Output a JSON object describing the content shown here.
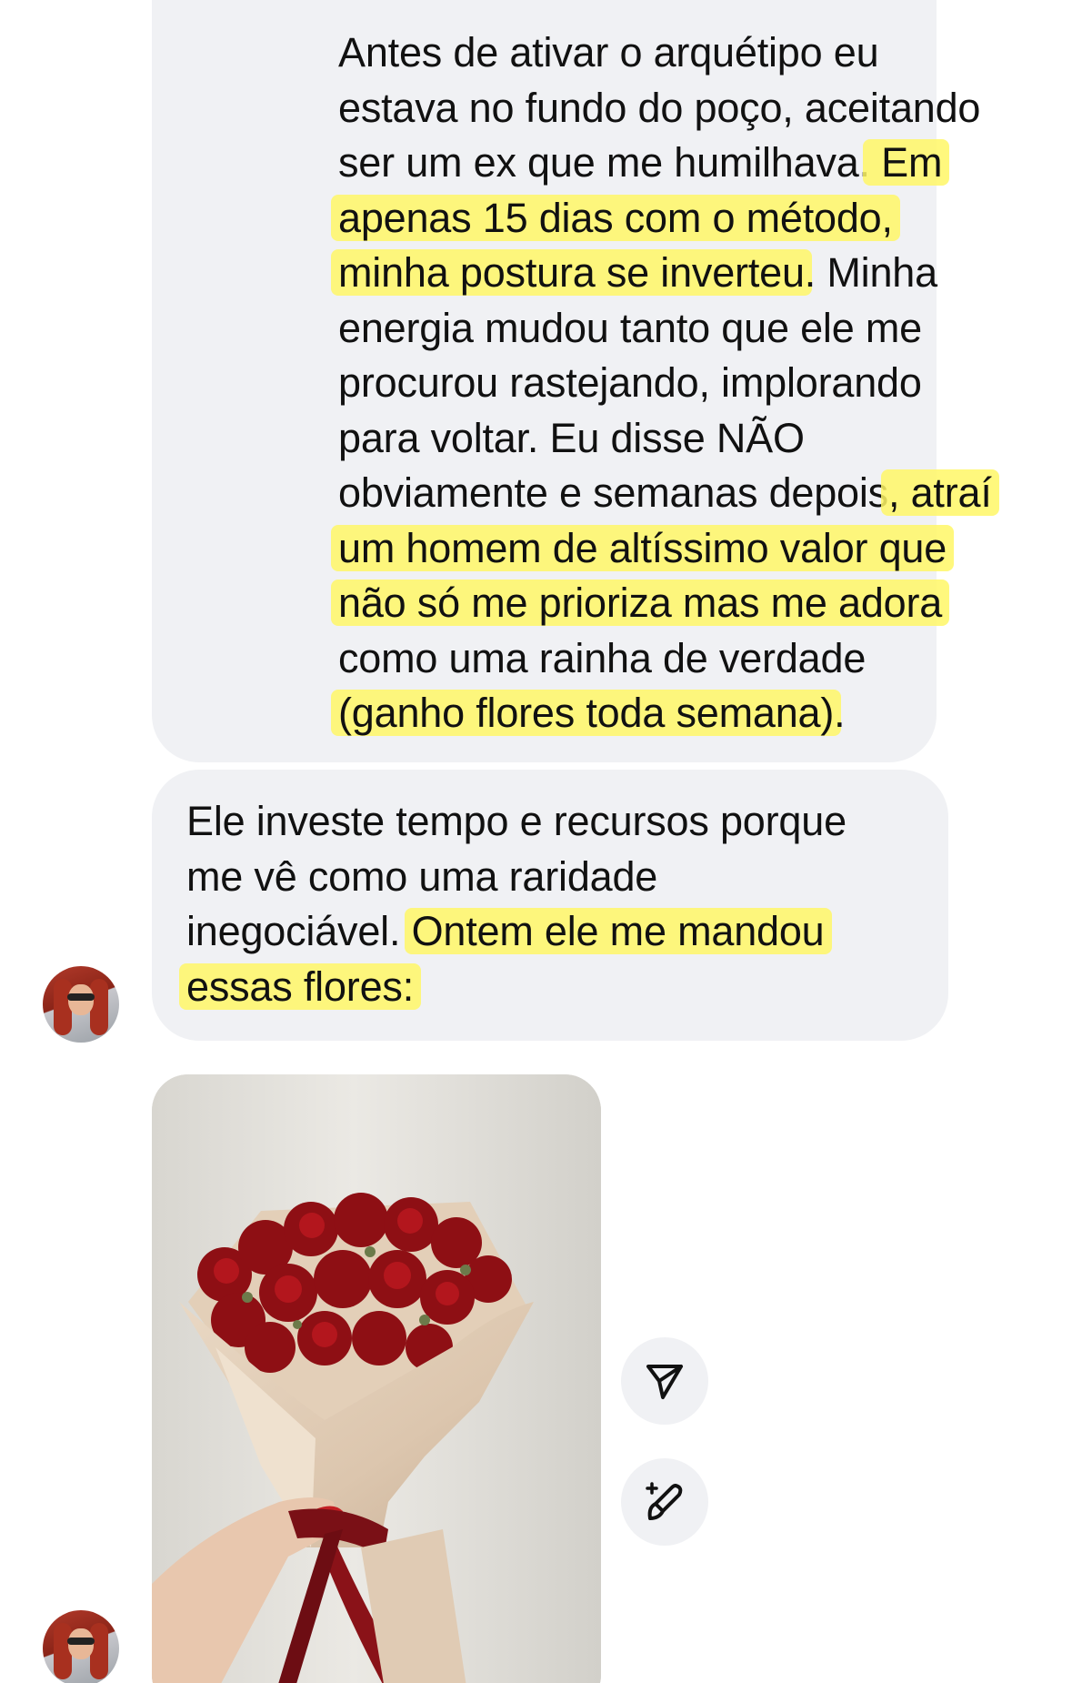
{
  "messages": [
    {
      "lines": [
        [
          {
            "t": "Antes de ativar o arquétipo eu",
            "h": false
          }
        ],
        [
          {
            "t": "estava no fundo do poço, aceitando",
            "h": false
          }
        ],
        [
          {
            "t": "ser um ex que me humilhava.",
            "h": false
          },
          {
            "t": " Em",
            "h": true
          }
        ],
        [
          {
            "t": "apenas 15 dias com o método,",
            "h": true
          }
        ],
        [
          {
            "t": "minha postura se inverteu",
            "h": true
          },
          {
            "t": ". Minha",
            "h": false
          }
        ],
        [
          {
            "t": "energia mudou tanto que ele me",
            "h": false
          }
        ],
        [
          {
            "t": "procurou rastejando, implorando",
            "h": false
          }
        ],
        [
          {
            "t": "para voltar. Eu disse NÃO",
            "h": false
          }
        ],
        [
          {
            "t": "obviamente e semanas depois",
            "h": false
          },
          {
            "t": ", atraí",
            "h": true
          }
        ],
        [
          {
            "t": "um homem de altíssimo valor que",
            "h": true
          }
        ],
        [
          {
            "t": "não só me prioriza mas me adora",
            "h": true
          }
        ],
        [
          {
            "t": "como uma rainha de verdade",
            "h": false
          }
        ],
        [
          {
            "t": "(ganho flores toda semana)",
            "h": true
          },
          {
            "t": ".",
            "h": false
          }
        ]
      ]
    },
    {
      "lines": [
        [
          {
            "t": "Ele investe tempo e recursos porque",
            "h": false
          }
        ],
        [
          {
            "t": "me vê como uma raridade",
            "h": false
          }
        ],
        [
          {
            "t": "inegociável. ",
            "h": false
          },
          {
            "t": "Ontem ele me mandou",
            "h": true
          }
        ],
        [
          {
            "t": "essas flores:",
            "h": true
          }
        ]
      ]
    }
  ],
  "attachment": {
    "kind": "photo",
    "subject": "bouquet of red roses in beige wrapping paper held in a hand"
  },
  "actions": {
    "share_icon": "send-icon",
    "restyle_icon": "magic-brush-icon"
  },
  "colors": {
    "bubble": "#f0f1f4",
    "highlight": "#fff766",
    "background": "#ffffff",
    "text": "#111111"
  }
}
